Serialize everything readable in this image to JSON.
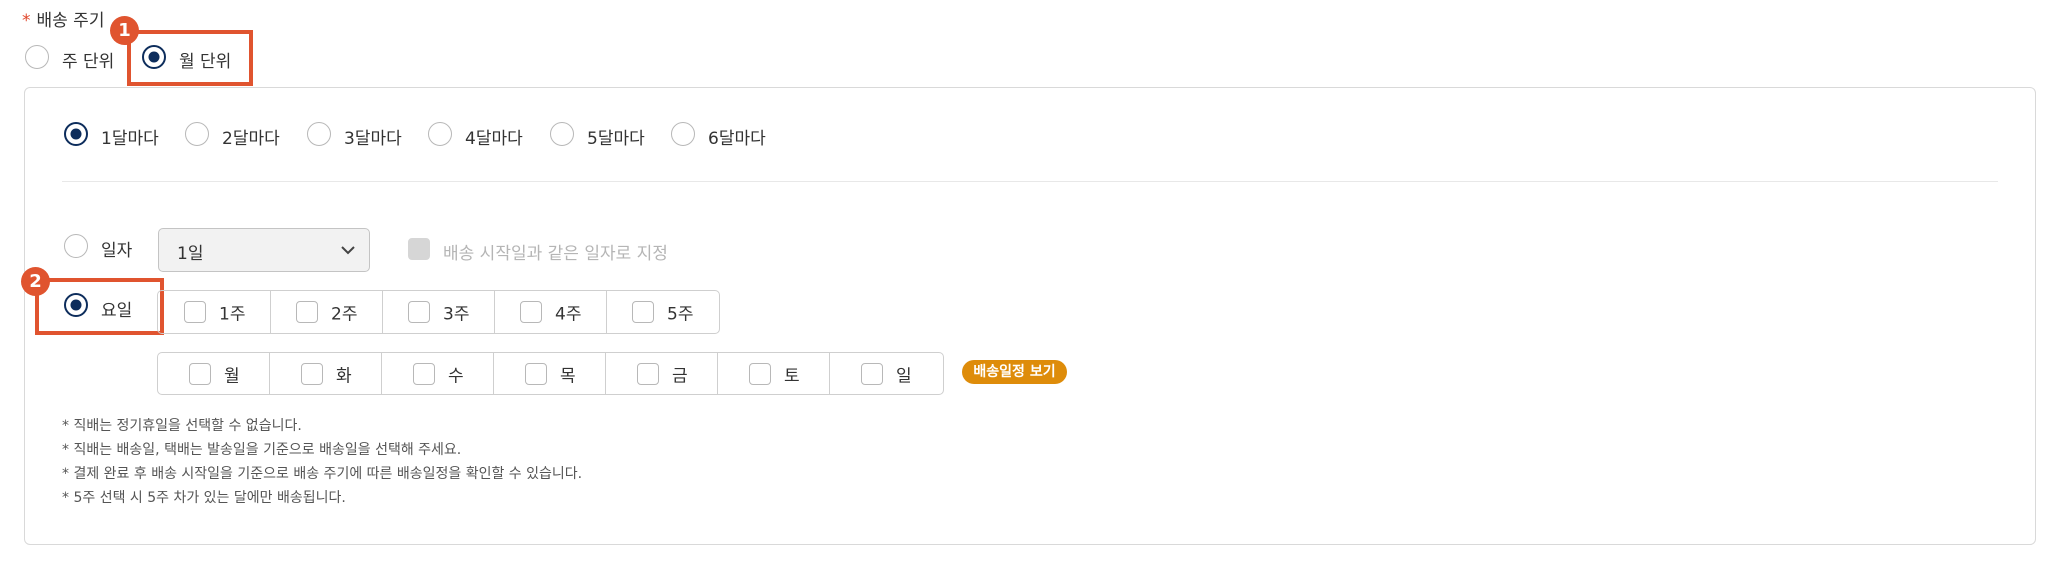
{
  "title": {
    "star": "*",
    "label": "배송 주기"
  },
  "cycle_unit": [
    {
      "label": "주 단위",
      "selected": false
    },
    {
      "label": "월 단위",
      "selected": true
    }
  ],
  "months": [
    {
      "label": "1달마다",
      "selected": true
    },
    {
      "label": "2달마다",
      "selected": false
    },
    {
      "label": "3달마다",
      "selected": false
    },
    {
      "label": "4달마다",
      "selected": false
    },
    {
      "label": "5달마다",
      "selected": false
    },
    {
      "label": "6달마다",
      "selected": false
    }
  ],
  "date_mode": {
    "label": "일자",
    "selected": false,
    "select_value": "1일",
    "same_date_label": "배송 시작일과 같은 일자로 지정"
  },
  "weekday_mode": {
    "label": "요일",
    "selected": true
  },
  "weeks": [
    "1주",
    "2주",
    "3주",
    "4주",
    "5주"
  ],
  "weekdays": [
    "월",
    "화",
    "수",
    "목",
    "금",
    "토",
    "일"
  ],
  "schedule_button": "배송일정 보기",
  "callouts": [
    "1",
    "2"
  ],
  "notes": [
    "* 직배는 정기휴일을 선택할 수 없습니다.",
    "* 직배는 배송일, 택배는 발송일을 기준으로 배송일을 선택해 주세요.",
    "* 결제 완료 후 배송 시작일을 기준으로 배송 주기에 따른 배송일정을 확인할 수 있습니다.",
    "* 5주 선택 시 5주 차가 있는 달에만 배송됩니다."
  ],
  "colors": {
    "accent": "#e0542f",
    "radio_selected": "#0d2d5c",
    "pill": "#de8c0a"
  }
}
